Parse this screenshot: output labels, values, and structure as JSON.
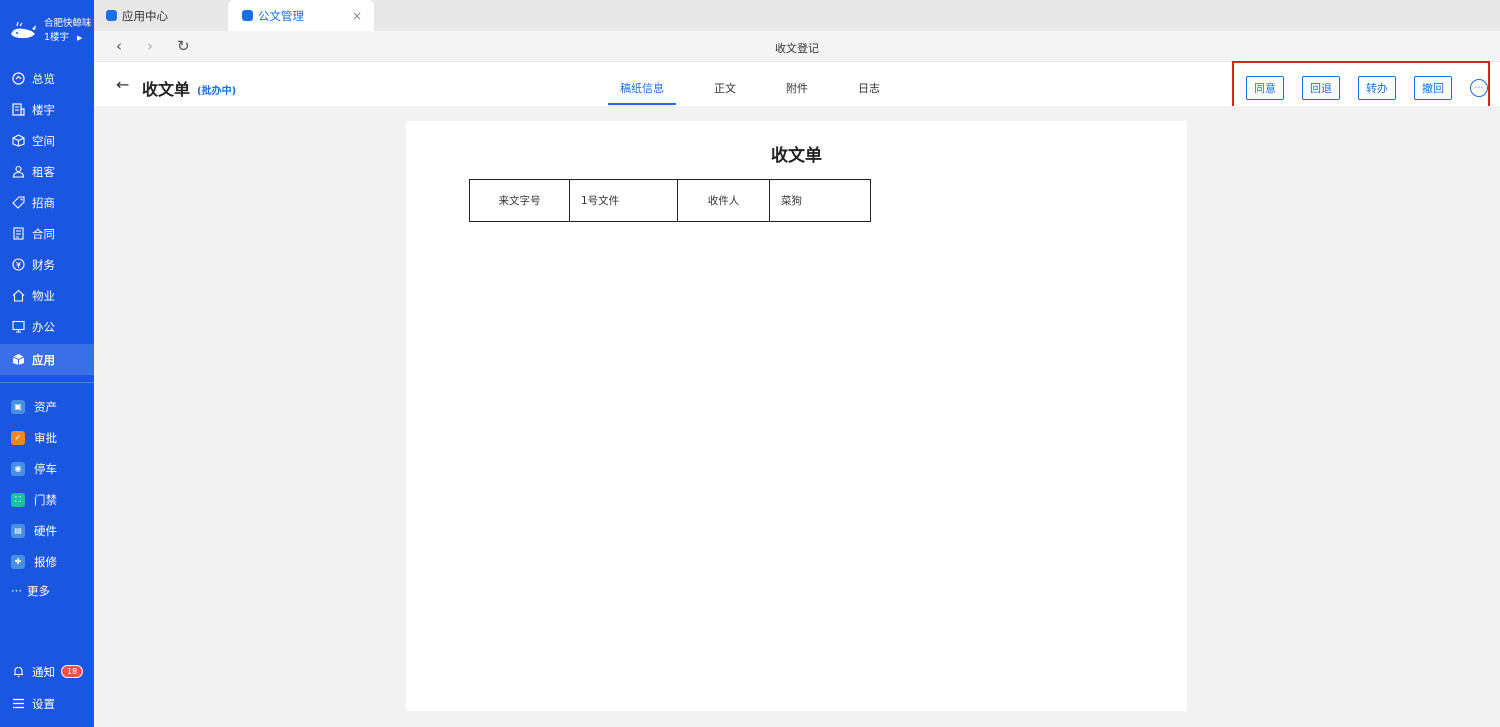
{
  "brand": {
    "name": "合肥快鲸味",
    "building": "1楼宇",
    "arrow": "▶"
  },
  "sidebar": {
    "items": [
      {
        "label": "总览",
        "icon": "dashboard-icon"
      },
      {
        "label": "楼宇",
        "icon": "building-icon"
      },
      {
        "label": "空间",
        "icon": "cube-icon"
      },
      {
        "label": "租客",
        "icon": "users-icon"
      },
      {
        "label": "招商",
        "icon": "tag-icon"
      },
      {
        "label": "合同",
        "icon": "document-icon"
      },
      {
        "label": "财务",
        "icon": "coin-icon"
      },
      {
        "label": "物业",
        "icon": "home-icon"
      },
      {
        "label": "办公",
        "icon": "monitor-icon"
      },
      {
        "label": "应用",
        "icon": "box-icon",
        "active": true
      }
    ],
    "apps": [
      {
        "label": "资产",
        "icon": "asset-icon",
        "color": "#4a90e2"
      },
      {
        "label": "审批",
        "icon": "approval-icon",
        "color": "#f08a24"
      },
      {
        "label": "停车",
        "icon": "parking-icon",
        "color": "#4a90e2"
      },
      {
        "label": "门禁",
        "icon": "access-icon",
        "color": "#19c2a1"
      },
      {
        "label": "硬件",
        "icon": "hardware-icon",
        "color": "#4a90e2"
      },
      {
        "label": "报修",
        "icon": "repair-icon",
        "color": "#4a90e2"
      }
    ],
    "more_label": "更多",
    "notify_label": "通知",
    "notify_count": "18",
    "settings_label": "设置"
  },
  "tabs": [
    {
      "label": "应用中心"
    },
    {
      "label": "公文管理",
      "active": true
    }
  ],
  "tab_close": "×",
  "addr": {
    "back": "‹",
    "forward": "›",
    "reload": "↻",
    "title": "收文登记"
  },
  "header": {
    "back": "←",
    "title": "收文单",
    "status": "(批办中)",
    "doc_tabs": [
      "稿纸信息",
      "正文",
      "附件",
      "日志"
    ],
    "actions": [
      "同意",
      "回退",
      "转办",
      "撤回"
    ],
    "more": "⋯"
  },
  "paper": {
    "title": "收文单",
    "fields": [
      {
        "label": "来文字号",
        "value": "1号文件"
      },
      {
        "label": "收件人",
        "value": "菜狗"
      }
    ]
  },
  "colors": {
    "sidebar": "#1a56e0",
    "accent": "#1a6fe8",
    "highlight": "#e0201b"
  }
}
